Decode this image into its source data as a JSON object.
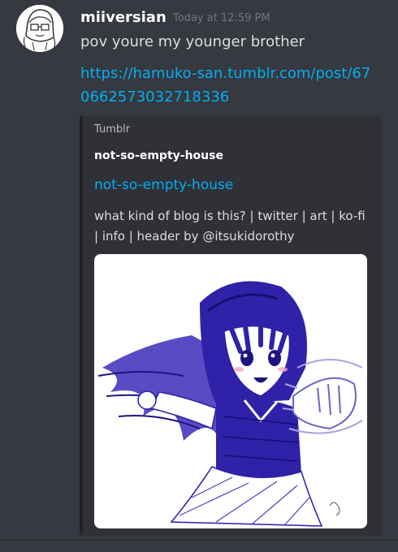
{
  "message": {
    "username": "miiversian",
    "timestamp": "Today at 12:59 PM",
    "text": "pov youre my younger brother",
    "link": "https://hamuko-san.tumblr.com/post/670662573032718336"
  },
  "embed": {
    "provider": "Tumblr",
    "author": "not-so-empty-house",
    "title": "not-so-empty-house",
    "description": "what kind of blog is this? | twitter | art | ko-fi | info | header by @itsukidorothy",
    "image_icon": "anime-girl-illustration"
  },
  "colors": {
    "background": "#36393f",
    "embed_background": "#2f3136",
    "link": "#00aff4",
    "ink": "#2a1ea8"
  }
}
